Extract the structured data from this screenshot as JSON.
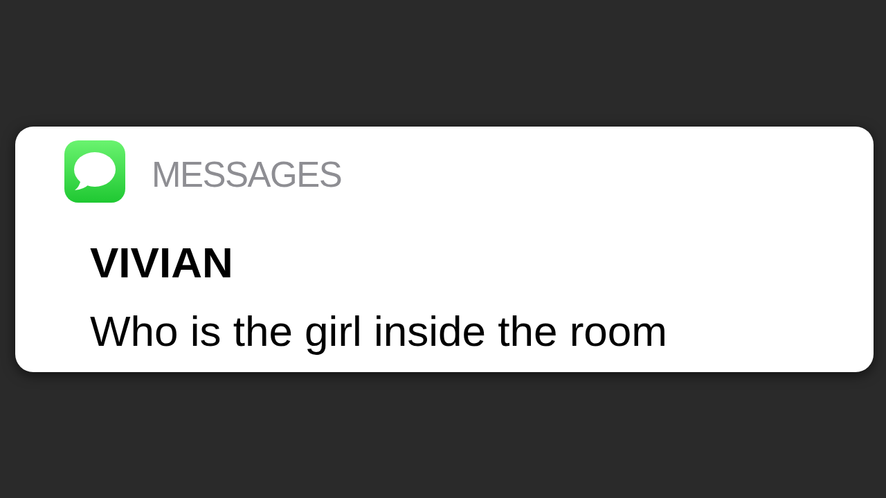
{
  "notification": {
    "app": "MESSAGES",
    "sender": "VIVIAN",
    "message": "Who is the girl inside the room"
  }
}
